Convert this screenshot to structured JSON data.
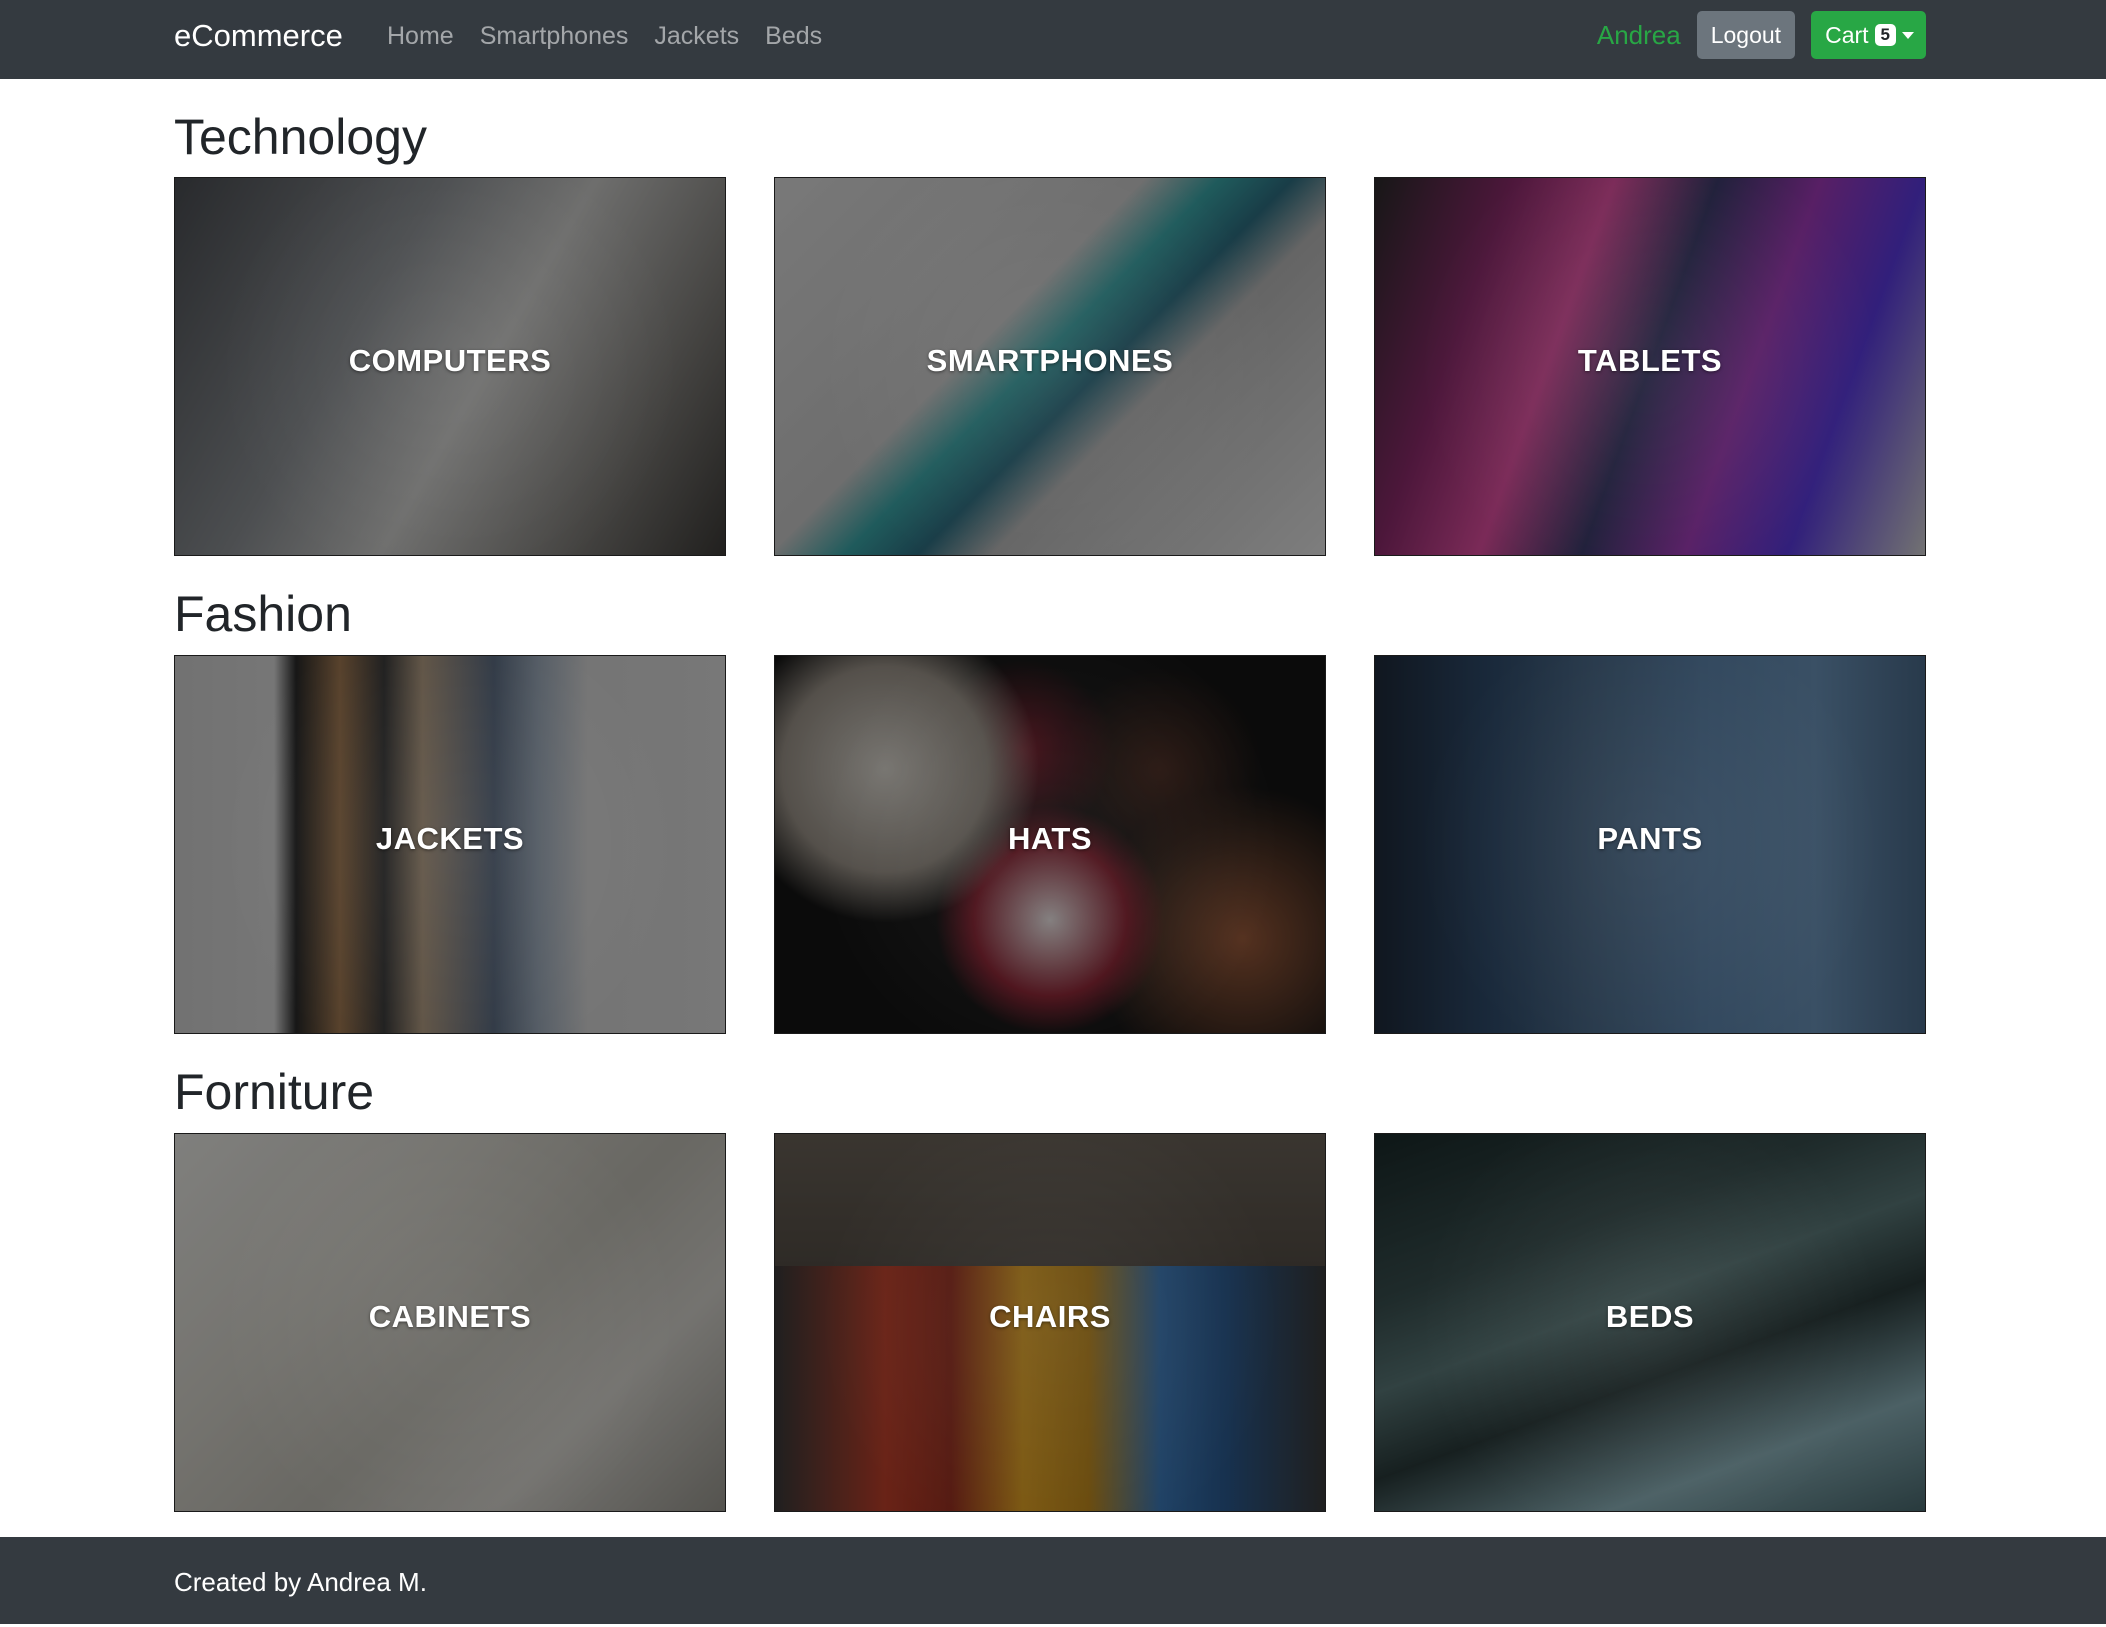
{
  "navbar": {
    "brand": "eCommerce",
    "links": [
      "Home",
      "Smartphones",
      "Jackets",
      "Beds"
    ],
    "username": "Andrea",
    "logout_label": "Logout",
    "cart_label": "Cart",
    "cart_count": "5",
    "colors": {
      "background": "#343a40",
      "username": "#28a745",
      "logout": "#6c757d",
      "cart": "#28a745"
    }
  },
  "sections": [
    {
      "title": "Technology",
      "cards": [
        "COMPUTERS",
        "SMARTPHONES",
        "TABLETS"
      ]
    },
    {
      "title": "Fashion",
      "cards": [
        "JACKETS",
        "HATS",
        "PANTS"
      ]
    },
    {
      "title": "Forniture",
      "cards": [
        "CABINETS",
        "CHAIRS",
        "BEDS"
      ]
    }
  ],
  "footer": {
    "text": "Created by Andrea M."
  }
}
